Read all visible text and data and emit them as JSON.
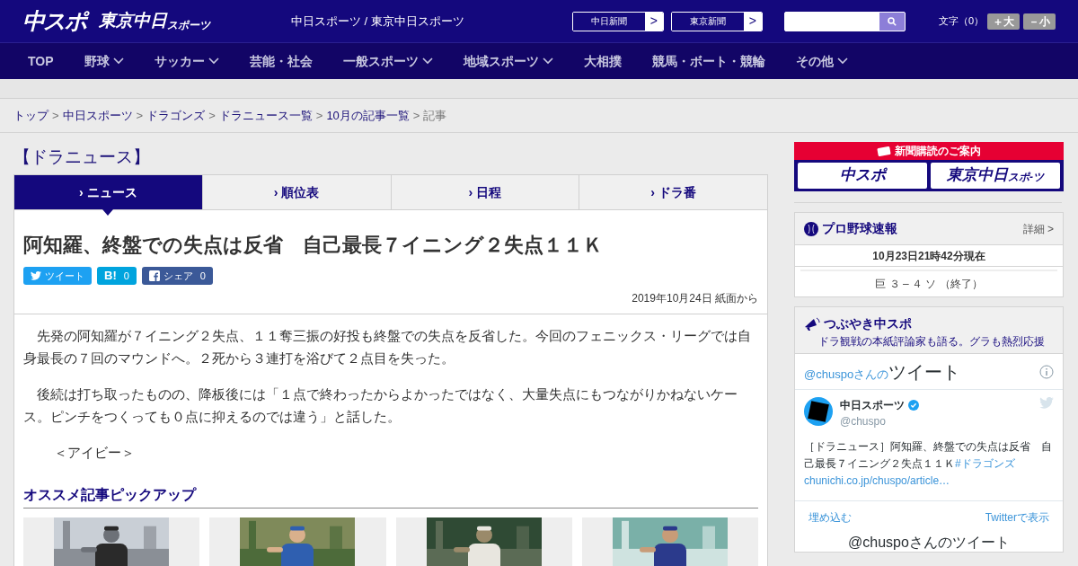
{
  "header": {
    "logo_main": "中スポ",
    "logo_tokyo": "東京中日",
    "logo_tokyo_sub": "スポーツ",
    "site_links": "中日スポーツ / 東京中日スポーツ",
    "paper_links": [
      {
        "label": "中日新聞",
        "arrow": ">"
      },
      {
        "label": "東京新聞",
        "arrow": ">"
      }
    ],
    "font_size_label": "文字（0）",
    "font_buttons": [
      "＋大",
      "－小"
    ]
  },
  "nav": [
    {
      "label": "TOP",
      "dropdown": false
    },
    {
      "label": "野球",
      "dropdown": true
    },
    {
      "label": "サッカー",
      "dropdown": true
    },
    {
      "label": "芸能・社会",
      "dropdown": false
    },
    {
      "label": "一般スポーツ",
      "dropdown": true
    },
    {
      "label": "地域スポーツ",
      "dropdown": true
    },
    {
      "label": "大相撲",
      "dropdown": false
    },
    {
      "label": "競馬・ボート・競輪",
      "dropdown": false
    },
    {
      "label": "その他",
      "dropdown": true
    }
  ],
  "breadcrumb": [
    {
      "label": "トップ",
      "link": true
    },
    {
      "label": "中日スポーツ",
      "link": true
    },
    {
      "label": "ドラゴンズ",
      "link": true
    },
    {
      "label": "ドラニュース一覧",
      "link": true
    },
    {
      "label": "10月の記事一覧",
      "link": true
    },
    {
      "label": "記事",
      "link": false
    }
  ],
  "section_title": "【ドラニュース】",
  "tabs": [
    {
      "marker": "›",
      "label": "ニュース",
      "selected": true
    },
    {
      "marker": "›",
      "label": "順位表",
      "selected": false
    },
    {
      "marker": "›",
      "label": "日程",
      "selected": false
    },
    {
      "marker": "›",
      "label": "ドラ番",
      "selected": false
    }
  ],
  "article": {
    "title": "阿知羅、終盤での失点は反省　自己最長７イニング２失点１１Ｋ",
    "share": [
      {
        "kind": "twitter",
        "label": "ツイート"
      },
      {
        "kind": "hatena",
        "label": "B!",
        "count": "0"
      },
      {
        "kind": "facebook",
        "label": "シェア",
        "count": "0"
      }
    ],
    "date": "2019年10月24日 紙面から",
    "paragraphs": [
      "　先発の阿知羅が７イニング２失点、１１奪三振の好投も終盤での失点を反省した。今回のフェニックス・リーグでは自身最長の７回のマウンドへ。２死から３連打を浴びて２点目を失った。",
      "　後続は打ち取ったものの、降板後には「１点で終わったからよかったではなく、大量失点にもつながりかねないケース。ピンチをつくっても０点に抑えるのでは違う」と話した。"
    ],
    "byline": "＜アイビー＞"
  },
  "pickup": {
    "title": "オススメ記事ピックアップ"
  },
  "subscription": {
    "title": "新聞購読のご案内",
    "logos": [
      "中スポ",
      "東京中日"
    ],
    "logo_sub": "スポ-ツ"
  },
  "baseball": {
    "title": "プロ野球速報",
    "detail": "詳細 >",
    "updated": "10月23日21時42分現在",
    "score": "巨 ３ – ４ ソ （終了）"
  },
  "tweets": {
    "title": "つぶやき中スポ",
    "subtitle": "ドラ観戦の本紙評論家も語る。グラも熱烈応援",
    "header_handle": "@chuspoさんの",
    "header_word": "ツイート",
    "name": "中日スポーツ",
    "handle": "@chuspo",
    "text": "［ドラニュース］阿知羅、終盤での失点は反省　自己最長７イニング２失点１１Ｋ",
    "hashtag": "#ドラゴンズ",
    "link": "chunichi.co.jp/chuspo/article…",
    "embed": "埋め込む",
    "view": "Twitterで表示",
    "footer": "@chuspoさんのツイート"
  }
}
